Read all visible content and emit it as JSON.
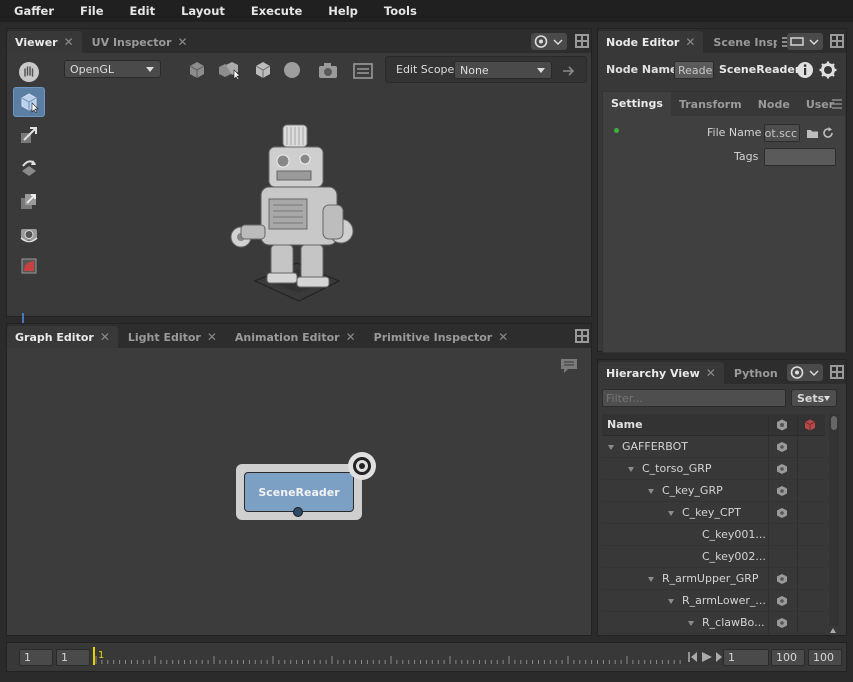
{
  "menubar": {
    "items": [
      "Gaffer",
      "File",
      "Edit",
      "Layout",
      "Execute",
      "Help",
      "Tools"
    ]
  },
  "viewer": {
    "tabs": [
      {
        "label": "Viewer",
        "active": true
      },
      {
        "label": "UV Inspector",
        "active": false
      }
    ],
    "renderer": "OpenGL",
    "edit_scope_label": "Edit Scope",
    "edit_scope_value": "None",
    "tools": [
      "hand-tool",
      "selection-tool",
      "translate-tool",
      "rotate-tool",
      "scale-tool",
      "camera-tool",
      "crop-window-tool"
    ]
  },
  "graph_editor": {
    "tabs": [
      {
        "label": "Graph Editor",
        "active": true
      },
      {
        "label": "Light Editor",
        "active": false
      },
      {
        "label": "Animation Editor",
        "active": false
      },
      {
        "label": "Primitive Inspector",
        "active": false
      }
    ],
    "node_label": "SceneReader"
  },
  "node_editor": {
    "tabs": [
      {
        "label": "Node Editor",
        "active": true
      },
      {
        "label": "Scene Insp",
        "active": false
      }
    ],
    "node_name_label": "Node Name",
    "node_type_badge": "Reader",
    "node_type": "SceneReader",
    "section_tabs": [
      {
        "label": "Settings",
        "active": true
      },
      {
        "label": "Transform",
        "active": false
      },
      {
        "label": "Node",
        "active": false
      },
      {
        "label": "User",
        "active": false
      }
    ],
    "file_name_label": "File Name",
    "file_name_value": "ot.scc",
    "tags_label": "Tags",
    "tags_value": ""
  },
  "hierarchy": {
    "tabs": [
      {
        "label": "Hierarchy View",
        "active": true
      },
      {
        "label": "Python",
        "active": false
      }
    ],
    "filter_placeholder": "Filter...",
    "sets_label": "Sets",
    "column_name": "Name",
    "rows": [
      {
        "name": "GAFFERBOT",
        "depth": 0,
        "expanded": true,
        "has_children": true
      },
      {
        "name": "C_torso_GRP",
        "depth": 1,
        "expanded": true,
        "has_children": true
      },
      {
        "name": "C_key_GRP",
        "depth": 2,
        "expanded": true,
        "has_children": true
      },
      {
        "name": "C_key_CPT",
        "depth": 3,
        "expanded": true,
        "has_children": true
      },
      {
        "name": "C_key001...",
        "depth": 4,
        "expanded": false,
        "has_children": false
      },
      {
        "name": "C_key002...",
        "depth": 4,
        "expanded": false,
        "has_children": false
      },
      {
        "name": "R_armUpper_GRP",
        "depth": 2,
        "expanded": true,
        "has_children": true
      },
      {
        "name": "R_armLower_...",
        "depth": 3,
        "expanded": true,
        "has_children": true
      },
      {
        "name": "R_clawBo...",
        "depth": 4,
        "expanded": true,
        "has_children": true
      }
    ]
  },
  "timeline": {
    "range_start": "1",
    "visible_start": "1",
    "current_frame_marker": "1",
    "current_frame": "1",
    "visible_end": "100",
    "range_end": "100"
  },
  "colors": {
    "accent": "#5b7ea3",
    "node_fill": "#7c9fc4",
    "panel_bg": "#383838",
    "frame_marker": "#e6d400"
  }
}
